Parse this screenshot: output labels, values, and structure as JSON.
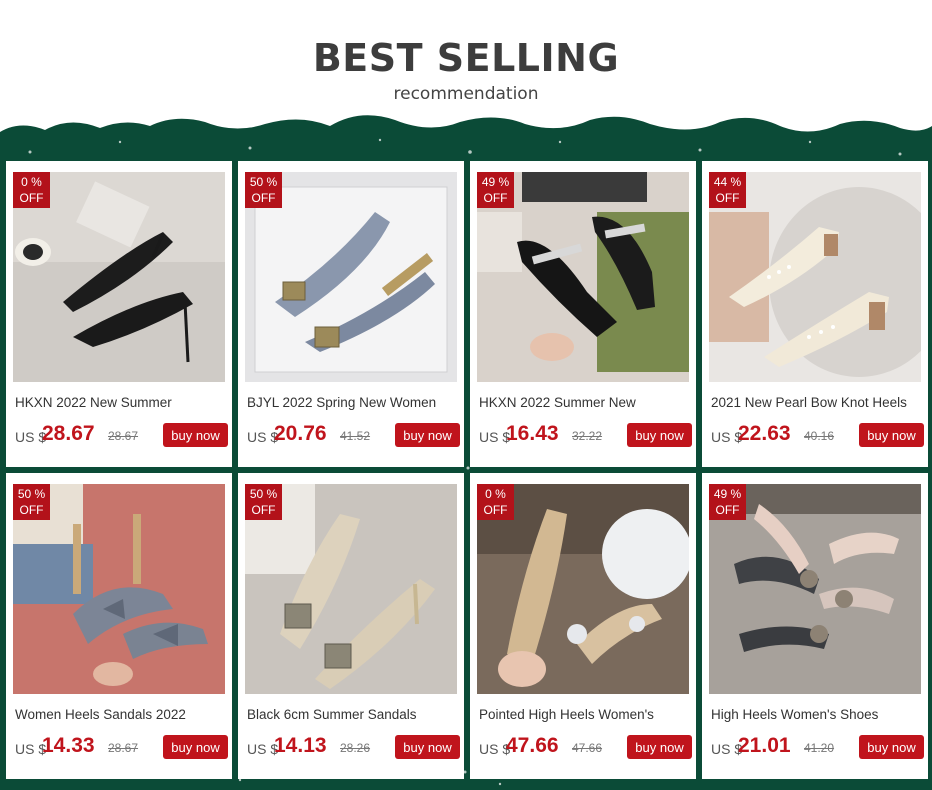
{
  "header": {
    "title": "BEST SELLING",
    "subtitle": "recommendation"
  },
  "colors": {
    "band": "#0b4b37",
    "accent": "#c0141c",
    "badge": "#b3121a"
  },
  "products": [
    {
      "discount": "0 %",
      "off": "OFF",
      "name": "HKXN 2022 New Summer",
      "currency": "US $",
      "price": "28.67",
      "old_price": "28.67",
      "buy_label": "buy now",
      "image": "black-ankle-strap-heels"
    },
    {
      "discount": "50 %",
      "off": "OFF",
      "name": "BJYL 2022 Spring New Women",
      "currency": "US $",
      "price": "20.76",
      "old_price": "41.52",
      "buy_label": "buy now",
      "image": "blue-satin-buckle-heels"
    },
    {
      "discount": "49 %",
      "off": "OFF",
      "name": "HKXN 2022 Summer New",
      "currency": "US $",
      "price": "16.43",
      "old_price": "32.22",
      "buy_label": "buy now",
      "image": "black-rhinestone-mules"
    },
    {
      "discount": "44 %",
      "off": "OFF",
      "name": "2021 New Pearl Bow Knot Heels",
      "currency": "US $",
      "price": "22.63",
      "old_price": "40.16",
      "buy_label": "buy now",
      "image": "cream-pearl-block-heels"
    },
    {
      "discount": "50 %",
      "off": "OFF",
      "name": "Women Heels Sandals 2022",
      "currency": "US $",
      "price": "14.33",
      "old_price": "28.67",
      "buy_label": "buy now",
      "image": "grey-bow-sandals"
    },
    {
      "discount": "50 %",
      "off": "OFF",
      "name": "Black 6cm Summer Sandals",
      "currency": "US $",
      "price": "14.13",
      "old_price": "28.26",
      "buy_label": "buy now",
      "image": "beige-lace-buckle-heels"
    },
    {
      "discount": "0 %",
      "off": "OFF",
      "name": "Pointed High Heels Women's",
      "currency": "US $",
      "price": "47.66",
      "old_price": "47.66",
      "buy_label": "buy now",
      "image": "gold-glitter-flower-heels"
    },
    {
      "discount": "49 %",
      "off": "OFF",
      "name": "High Heels Women's Shoes",
      "currency": "US $",
      "price": "21.01",
      "old_price": "41.20",
      "buy_label": "buy now",
      "image": "rhinestone-flower-heels"
    }
  ]
}
